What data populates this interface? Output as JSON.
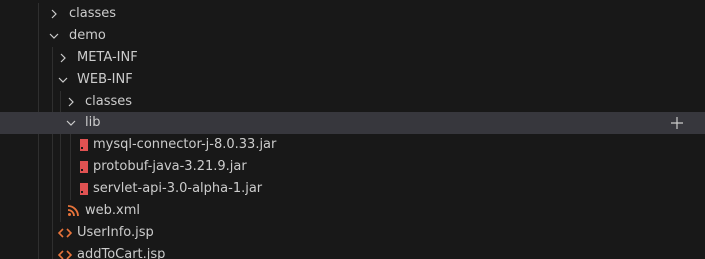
{
  "explorer": {
    "items": [
      {
        "label": "classes",
        "kind": "folder",
        "state": "collapsed"
      },
      {
        "label": "demo",
        "kind": "folder",
        "state": "expanded"
      },
      {
        "label": "META-INF",
        "kind": "folder",
        "state": "collapsed"
      },
      {
        "label": "WEB-INF",
        "kind": "folder",
        "state": "expanded"
      },
      {
        "label": "classes",
        "kind": "folder",
        "state": "collapsed"
      },
      {
        "label": "lib",
        "kind": "folder",
        "state": "expanded",
        "selected": true,
        "action_icon": "plus-icon"
      },
      {
        "label": "mysql-connector-j-8.0.33.jar",
        "kind": "file",
        "icon": "jar-file-icon"
      },
      {
        "label": "protobuf-java-3.21.9.jar",
        "kind": "file",
        "icon": "jar-file-icon"
      },
      {
        "label": "servlet-api-3.0-alpha-1.jar",
        "kind": "file",
        "icon": "jar-file-icon"
      },
      {
        "label": "web.xml",
        "kind": "file",
        "icon": "xml-rss-icon"
      },
      {
        "label": "UserInfo.jsp",
        "kind": "file",
        "icon": "jsp-code-icon"
      },
      {
        "label": "addToCart.jsp",
        "kind": "file",
        "icon": "jsp-code-icon"
      }
    ]
  },
  "colors": {
    "background": "#181818",
    "selected_row": "#37373d",
    "text": "#cccccc",
    "jar_icon": "#e05252",
    "xml_icon": "#e8743b",
    "jsp_icon": "#e8743b"
  }
}
